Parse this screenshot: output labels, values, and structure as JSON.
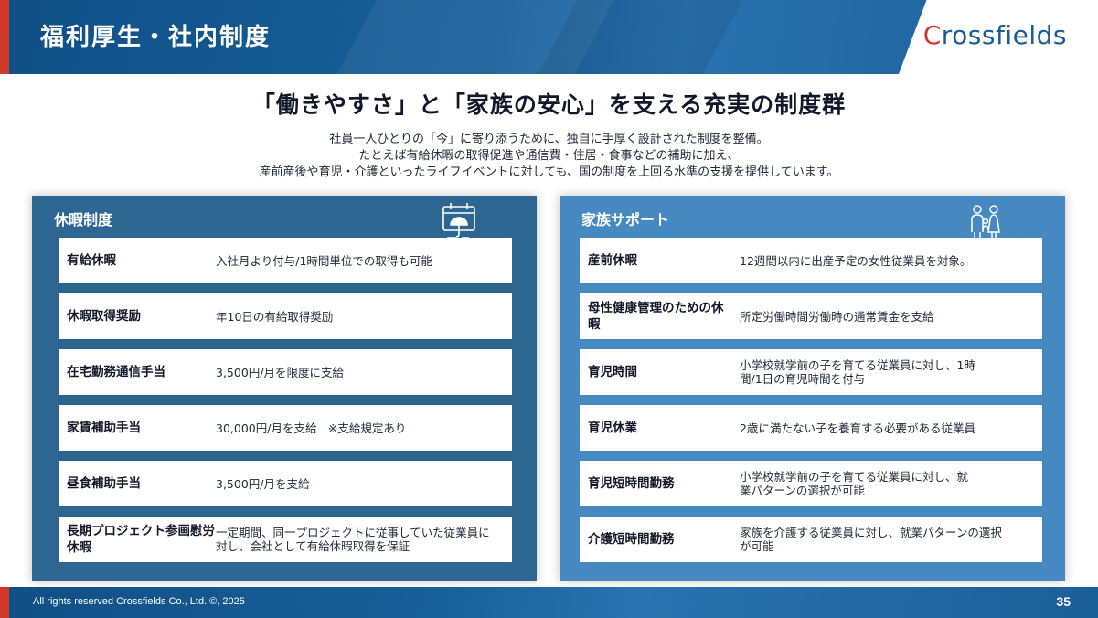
{
  "header": {
    "title": "福利厚生・社内制度",
    "logo": "Crossfields"
  },
  "headline": "「働きやすさ」と「家族の安心」を支える充実の制度群",
  "intro": [
    "社員一人ひとりの「今」に寄り添うために、独自に手厚く設計された制度を整備。",
    "たとえば有給休暇の取得促進や通信費・住居・食事などの補助に加え、",
    "産前産後や育児・介護といったライフイベントに対しても、国の制度を上回る水準の支援を提供しています。"
  ],
  "panels": {
    "leave": {
      "title": "休暇制度",
      "icon": "calendar-umbrella-icon",
      "items": [
        {
          "name": "有給休暇",
          "desc": "入社月より付与/1時間単位での取得も可能"
        },
        {
          "name": "休暇取得奨励",
          "desc": "年10日の有給取得奨励"
        },
        {
          "name": "在宅勤務通信手当",
          "desc": "3,500円/月を限度に支給"
        },
        {
          "name": "家賃補助手当",
          "desc": "30,000円/月を支給　※支給規定あり"
        },
        {
          "name": "昼食補助手当",
          "desc": "3,500円/月を支給"
        },
        {
          "name": "長期プロジェクト参画慰労休暇",
          "desc": "一定期間、同一プロジェクトに従事していた従業員に対し、会社として有給休暇取得を保証"
        }
      ]
    },
    "family": {
      "title": "家族サポート",
      "icon": "family-icon",
      "items": [
        {
          "name": "産前休暇",
          "desc": "12週間以内に出産予定の女性従業員を対象。"
        },
        {
          "name": "母性健康管理のための休暇",
          "desc": "所定労働時間労働時の通常賃金を支給"
        },
        {
          "name": "育児時間",
          "desc": "小学校就学前の子を育てる従業員に対し、1時間/1日の育児時間を付与"
        },
        {
          "name": "育児休業",
          "desc": "2歳に満たない子を養育する必要がある従業員"
        },
        {
          "name": "育児短時間勤務",
          "desc": "小学校就学前の子を育てる従業員に対し、就業パターンの選択が可能"
        },
        {
          "name": "介護短時間勤務",
          "desc": "家族を介護する従業員に対し、就業パターンの選択が可能"
        }
      ]
    }
  },
  "footer": {
    "copyright": "All rights reserved Crossfields Co., Ltd. ©, 2025",
    "page_number": "35"
  },
  "colors": {
    "header_blue": "#18609a",
    "accent_red": "#d0382b",
    "leave_panel": "#2e6692",
    "family_panel": "#4689c0"
  }
}
